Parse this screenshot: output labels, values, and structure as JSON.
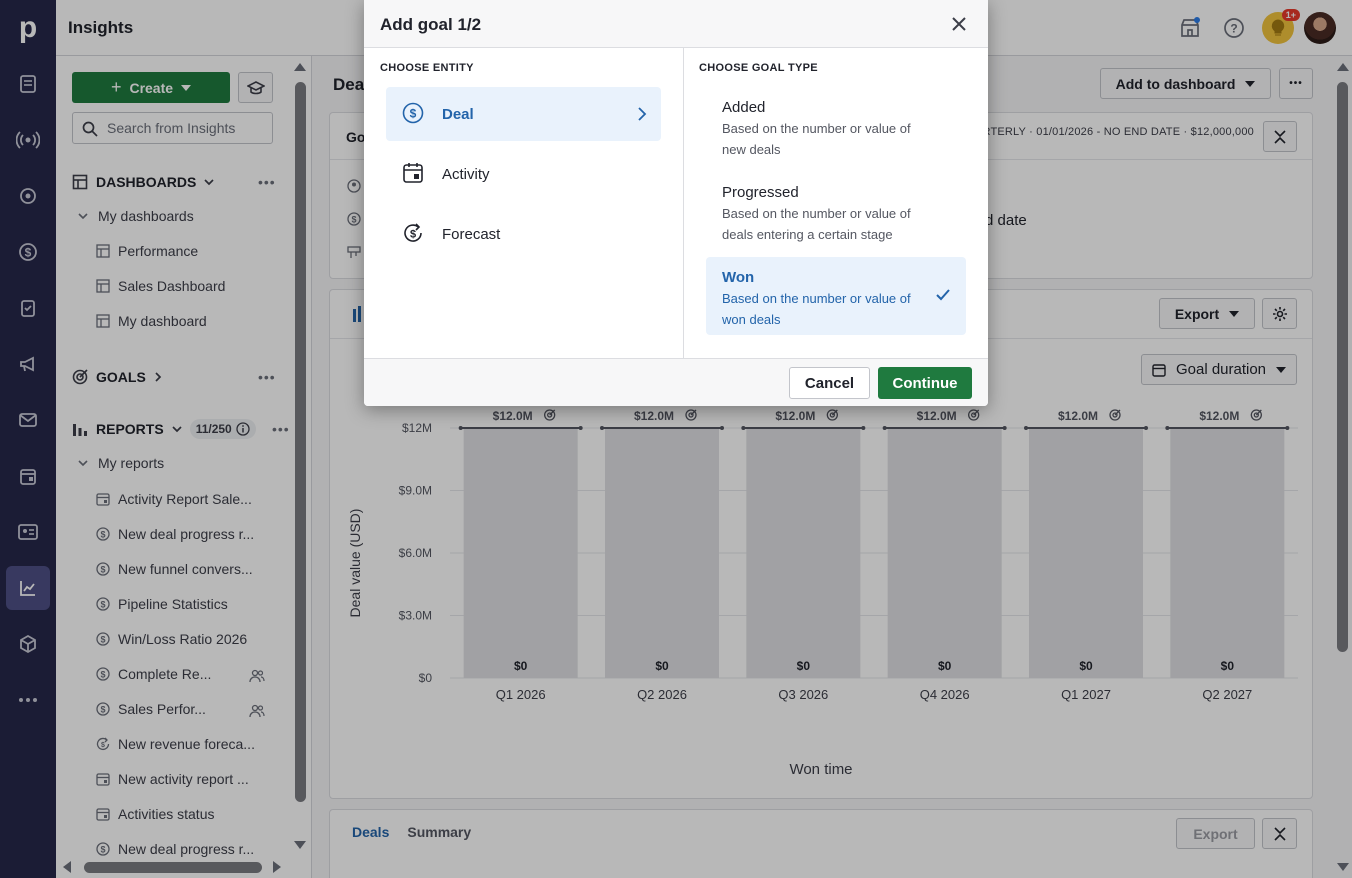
{
  "app": {
    "logo_letter": "p"
  },
  "topbar": {
    "title": "Insights",
    "notification_badge": "1+"
  },
  "sidebar": {
    "create_label": "Create",
    "search_placeholder": "Search from Insights",
    "dashboards": {
      "label": "DASHBOARDS",
      "group_label": "My dashboards",
      "items": [
        "Performance",
        "Sales Dashboard",
        "My dashboard"
      ]
    },
    "goals": {
      "label": "GOALS"
    },
    "reports": {
      "label": "REPORTS",
      "count": "11/250",
      "group_label": "My reports",
      "items": [
        {
          "label": "Activity Report Sale...",
          "icon": "calendar-icon",
          "shared": false
        },
        {
          "label": "New deal progress r...",
          "icon": "dollar-icon",
          "shared": false
        },
        {
          "label": "New funnel convers...",
          "icon": "dollar-icon",
          "shared": false
        },
        {
          "label": "Pipeline Statistics",
          "icon": "dollar-icon",
          "shared": false
        },
        {
          "label": "Win/Loss Ratio 2026",
          "icon": "dollar-icon",
          "shared": false
        },
        {
          "label": "Complete Re...",
          "icon": "dollar-icon",
          "shared": true
        },
        {
          "label": "Sales Perfor...",
          "icon": "dollar-icon",
          "shared": true
        },
        {
          "label": "New revenue foreca...",
          "icon": "forecast-icon",
          "shared": false
        },
        {
          "label": "New activity report ...",
          "icon": "calendar-icon",
          "shared": false
        },
        {
          "label": "Activities status",
          "icon": "calendar-icon",
          "shared": false
        },
        {
          "label": "New deal progress r...",
          "icon": "dollar-icon",
          "shared": false
        }
      ]
    }
  },
  "main": {
    "title_partial": "Dea",
    "add_to_dashboard": "Add to dashboard",
    "goal_card": {
      "title_partial": "Go",
      "meta": "RTERLY  ·  01/01/2026 - NO END DATE  ·  $12,000,000",
      "detail_partial": "d date"
    },
    "export_label": "Export",
    "goal_duration_label": "Goal duration",
    "bottom_tabs": [
      "Deals",
      "Summary"
    ],
    "bottom_export": "Export"
  },
  "chart_data": {
    "type": "bar",
    "categories": [
      "Q1 2026",
      "Q2 2026",
      "Q3 2026",
      "Q4 2026",
      "Q1 2027",
      "Q2 2027"
    ],
    "series": [
      {
        "values": [
          0,
          0,
          0,
          0,
          0,
          0
        ]
      }
    ],
    "value_labels": [
      "$0",
      "$0",
      "$0",
      "$0",
      "$0",
      "$0"
    ],
    "goal_values": [
      12000000,
      12000000,
      12000000,
      12000000,
      12000000,
      12000000
    ],
    "goal_labels": [
      "$12.0M",
      "$12.0M",
      "$12.0M",
      "$12.0M",
      "$12.0M",
      "$12.0M"
    ],
    "yticks": [
      "$0",
      "$3.0M",
      "$6.0M",
      "$9.0M",
      "$12M"
    ],
    "ylim": [
      0,
      12000000
    ],
    "xlabel": "Won time",
    "ylabel": "Deal value (USD)",
    "grid": true
  },
  "modal": {
    "title": "Add goal 1/2",
    "entity_header": "CHOOSE ENTITY",
    "entities": [
      {
        "label": "Deal",
        "selected": true
      },
      {
        "label": "Activity",
        "selected": false
      },
      {
        "label": "Forecast",
        "selected": false
      }
    ],
    "type_header": "CHOOSE GOAL TYPE",
    "types": [
      {
        "title": "Added",
        "desc": "Based on the number or value of new deals",
        "selected": false
      },
      {
        "title": "Progressed",
        "desc": "Based on the number or value of deals entering a certain stage",
        "selected": false
      },
      {
        "title": "Won",
        "desc": "Based on the number or value of won deals",
        "selected": true
      }
    ],
    "cancel_label": "Cancel",
    "continue_label": "Continue"
  },
  "colors": {
    "accent_green": "#1f7a3f",
    "selected_blue": "#2364aa",
    "rail": "#26284a"
  }
}
